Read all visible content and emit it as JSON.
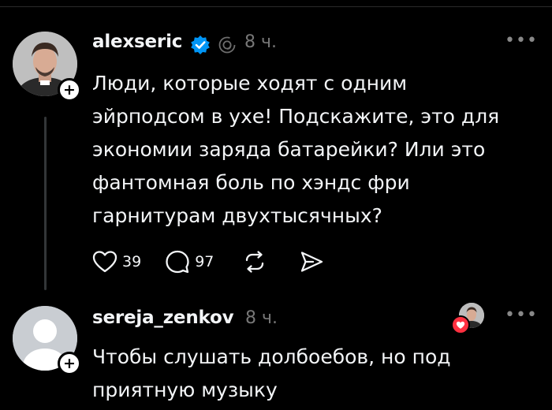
{
  "post": {
    "username": "alexseric",
    "time": "8 ч.",
    "text": "Люди, которые ходят с одним\nэйрподсом в ухе! Подскажите, это для\nэкономии заряда батарейки? Или это\nфантомная боль по хэндс фри\nгарнитурам двухтысячных?",
    "likes": "39",
    "comments": "97",
    "more_label": "•••",
    "follow_label": "+"
  },
  "reply": {
    "username": "sereja_zenkov",
    "time": "8 ч.",
    "text": "Чтобы слушать долбоебов, но под\nприятную музыку",
    "more_label": "•••",
    "follow_label": "+"
  },
  "icons": {
    "verified": "verified-badge-icon",
    "thread": "threads-logo-icon",
    "like": "heart-icon",
    "comment": "comment-bubble-icon",
    "repost": "repost-icon",
    "share": "send-icon"
  },
  "colors": {
    "background": "#000000",
    "text": "#f3f5f7",
    "muted": "#777777",
    "verified": "#0095f6",
    "like_heart": "#ff3040"
  }
}
